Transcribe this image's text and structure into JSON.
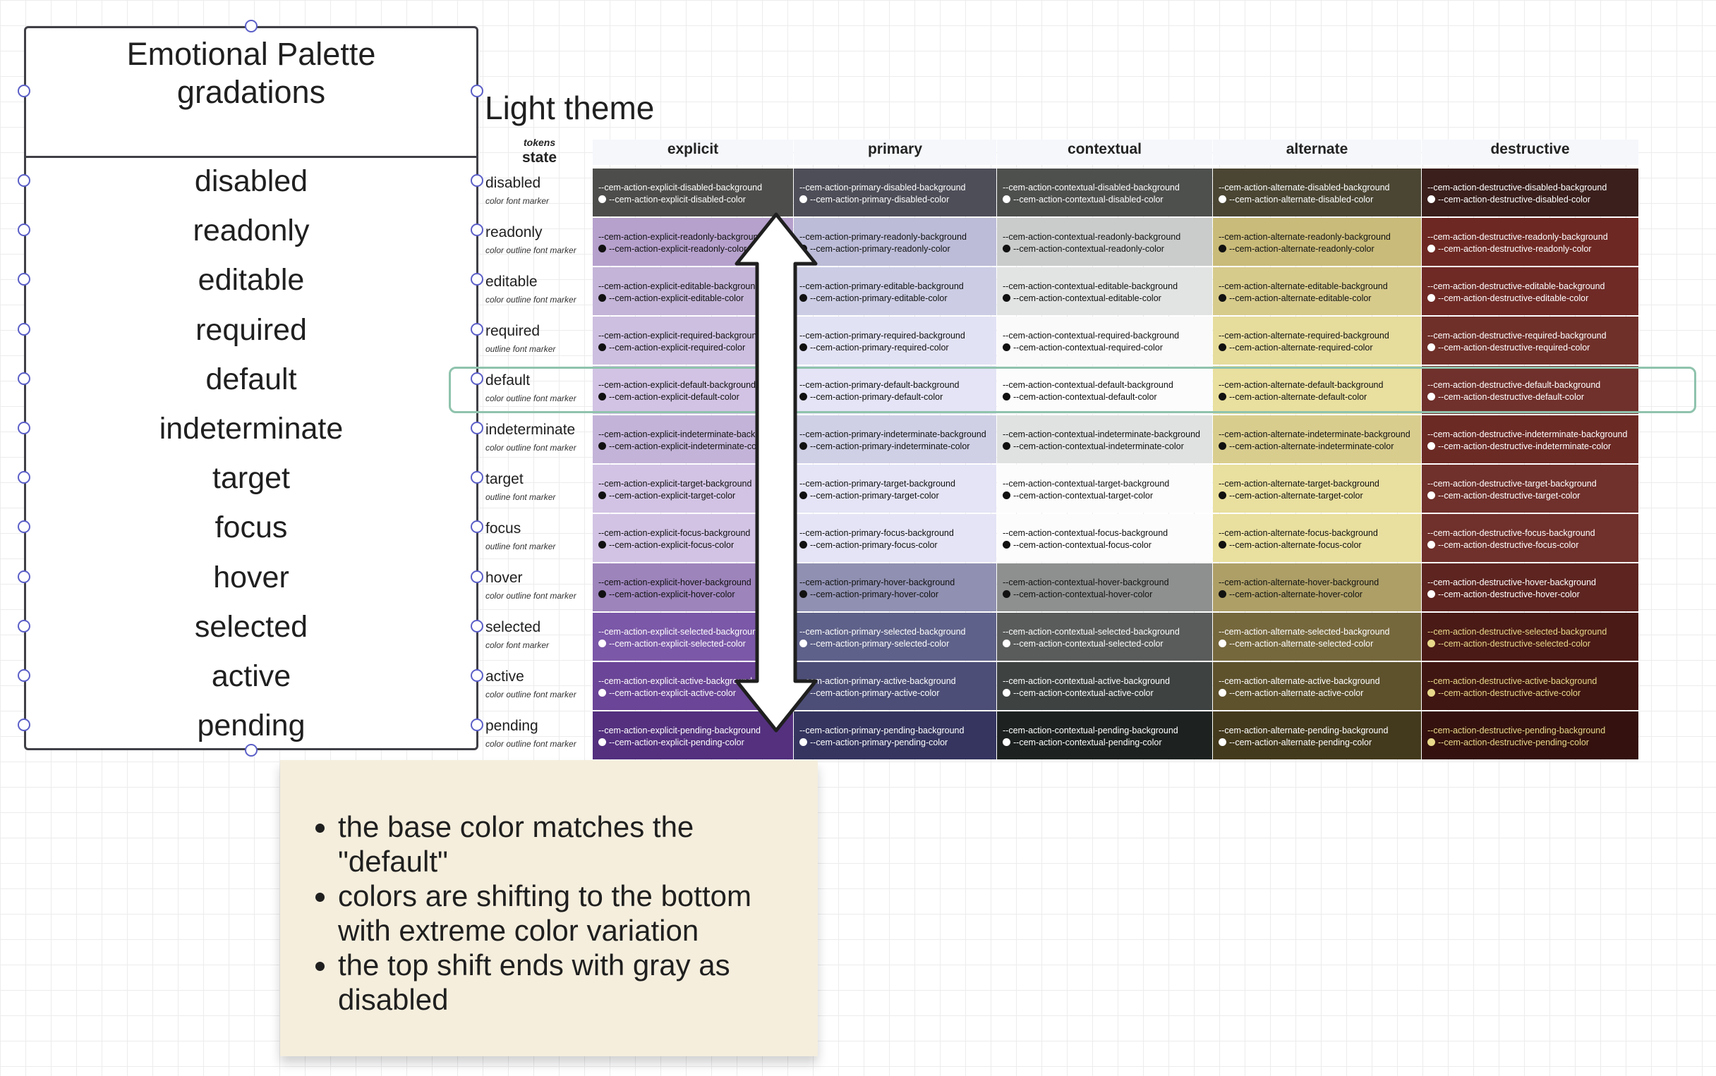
{
  "shape": {
    "title": "Emotional Palette gradations",
    "items": [
      "disabled",
      "readonly",
      "editable",
      "required",
      "default",
      "indeterminate",
      "target",
      "focus",
      "hover",
      "selected",
      "active",
      "pending"
    ]
  },
  "table": {
    "title": "Light theme",
    "tokens_label": "tokens",
    "state_label": "state",
    "columns": [
      "explicit",
      "primary",
      "contextual",
      "alternate",
      "destructive"
    ],
    "rows": [
      {
        "state": "disabled",
        "markers": "color font marker"
      },
      {
        "state": "readonly",
        "markers": "color outline font marker"
      },
      {
        "state": "editable",
        "markers": "color outline font marker"
      },
      {
        "state": "required",
        "markers": "outline font marker"
      },
      {
        "state": "default",
        "markers": "color outline font marker"
      },
      {
        "state": "indeterminate",
        "markers": "color outline font marker"
      },
      {
        "state": "target",
        "markers": "outline font marker"
      },
      {
        "state": "focus",
        "markers": "outline font marker"
      },
      {
        "state": "hover",
        "markers": "color outline font marker"
      },
      {
        "state": "selected",
        "markers": "color font marker"
      },
      {
        "state": "active",
        "markers": "color outline font marker"
      },
      {
        "state": "pending",
        "markers": "color outline font marker"
      }
    ],
    "cells": [
      [
        {
          "bg": "--cem-action-explicit-disabled-background",
          "fg": "--cem-action-explicit-disabled-color",
          "fill": "#4d4d4b",
          "text": "#ffffff"
        },
        {
          "bg": "--cem-action-primary-disabled-background",
          "fg": "--cem-action-primary-disabled-color",
          "fill": "#4e4e59",
          "text": "#ffffff"
        },
        {
          "bg": "--cem-action-contextual-disabled-background",
          "fg": "--cem-action-contextual-disabled-color",
          "fill": "#4e504e",
          "text": "#ffffff"
        },
        {
          "bg": "--cem-action-alternate-disabled-background",
          "fg": "--cem-action-alternate-disabled-color",
          "fill": "#4a4633",
          "text": "#ffffff"
        },
        {
          "bg": "--cem-action-destructive-disabled-background",
          "fg": "--cem-action-destructive-disabled-color",
          "fill": "#3a1f1c",
          "text": "#ffffff"
        }
      ],
      [
        {
          "bg": "--cem-action-explicit-readonly-background",
          "fg": "--cem-action-explicit-readonly-color",
          "fill": "#b6a1cd",
          "text": "#111111"
        },
        {
          "bg": "--cem-action-primary-readonly-background",
          "fg": "--cem-action-primary-readonly-color",
          "fill": "#bcbcd8",
          "text": "#111111"
        },
        {
          "bg": "--cem-action-contextual-readonly-background",
          "fg": "--cem-action-contextual-readonly-color",
          "fill": "#cacccb",
          "text": "#111111"
        },
        {
          "bg": "--cem-action-alternate-readonly-background",
          "fg": "--cem-action-alternate-readonly-color",
          "fill": "#c9bb79",
          "text": "#111111"
        },
        {
          "bg": "--cem-action-destructive-readonly-background",
          "fg": "--cem-action-destructive-readonly-color",
          "fill": "#6e2823",
          "text": "#ffffff"
        }
      ],
      [
        {
          "bg": "--cem-action-explicit-editable-background",
          "fg": "--cem-action-explicit-editable-color",
          "fill": "#c4b4d8",
          "text": "#111111"
        },
        {
          "bg": "--cem-action-primary-editable-background",
          "fg": "--cem-action-primary-editable-color",
          "fill": "#cccde5",
          "text": "#111111"
        },
        {
          "bg": "--cem-action-contextual-editable-background",
          "fg": "--cem-action-contextual-editable-color",
          "fill": "#e2e4e3",
          "text": "#111111"
        },
        {
          "bg": "--cem-action-alternate-editable-background",
          "fg": "--cem-action-alternate-editable-color",
          "fill": "#d7cb8c",
          "text": "#111111"
        },
        {
          "bg": "--cem-action-destructive-editable-background",
          "fg": "--cem-action-destructive-editable-color",
          "fill": "#6f2a26",
          "text": "#ffffff"
        }
      ],
      [
        {
          "bg": "--cem-action-explicit-required-background",
          "fg": "--cem-action-explicit-required-color",
          "fill": "#cdbfe0",
          "text": "#111111"
        },
        {
          "bg": "--cem-action-primary-required-background",
          "fg": "--cem-action-primary-required-color",
          "fill": "#e2e2f5",
          "text": "#111111"
        },
        {
          "bg": "--cem-action-contextual-required-background",
          "fg": "--cem-action-contextual-required-color",
          "fill": "#fafafa",
          "text": "#111111"
        },
        {
          "bg": "--cem-action-alternate-required-background",
          "fg": "--cem-action-alternate-required-color",
          "fill": "#e6dc9c",
          "text": "#111111"
        },
        {
          "bg": "--cem-action-destructive-required-background",
          "fg": "--cem-action-destructive-required-color",
          "fill": "#70302a",
          "text": "#ffffff"
        }
      ],
      [
        {
          "bg": "--cem-action-explicit-default-background",
          "fg": "--cem-action-explicit-default-color",
          "fill": "#d2c3e4",
          "text": "#111111"
        },
        {
          "bg": "--cem-action-primary-default-background",
          "fg": "--cem-action-primary-default-color",
          "fill": "#e4e4f6",
          "text": "#111111"
        },
        {
          "bg": "--cem-action-contextual-default-background",
          "fg": "--cem-action-contextual-default-color",
          "fill": "#fcfcfc",
          "text": "#111111"
        },
        {
          "bg": "--cem-action-alternate-default-background",
          "fg": "--cem-action-alternate-default-color",
          "fill": "#e9df9e",
          "text": "#111111"
        },
        {
          "bg": "--cem-action-destructive-default-background",
          "fg": "--cem-action-destructive-default-color",
          "fill": "#70302b",
          "text": "#ffffff"
        }
      ],
      [
        {
          "bg": "--cem-action-explicit-indeterminate-background",
          "fg": "--cem-action-explicit-indeterminate-color",
          "fill": "#c3b3d8",
          "text": "#111111"
        },
        {
          "bg": "--cem-action-primary-indeterminate-background",
          "fg": "--cem-action-primary-indeterminate-color",
          "fill": "#cfd0e6",
          "text": "#111111"
        },
        {
          "bg": "--cem-action-contextual-indeterminate-background",
          "fg": "--cem-action-contextual-indeterminate-color",
          "fill": "#e0e2e1",
          "text": "#111111"
        },
        {
          "bg": "--cem-action-alternate-indeterminate-background",
          "fg": "--cem-action-alternate-indeterminate-color",
          "fill": "#d9cd8e",
          "text": "#111111"
        },
        {
          "bg": "--cem-action-destructive-indeterminate-background",
          "fg": "--cem-action-destructive-indeterminate-color",
          "fill": "#6c2a25",
          "text": "#ffffff"
        }
      ],
      [
        {
          "bg": "--cem-action-explicit-target-background",
          "fg": "--cem-action-explicit-target-color",
          "fill": "#d2c3e4",
          "text": "#111111"
        },
        {
          "bg": "--cem-action-primary-target-background",
          "fg": "--cem-action-primary-target-color",
          "fill": "#e4e4f6",
          "text": "#111111"
        },
        {
          "bg": "--cem-action-contextual-target-background",
          "fg": "--cem-action-contextual-target-color",
          "fill": "#fcfcfc",
          "text": "#111111"
        },
        {
          "bg": "--cem-action-alternate-target-background",
          "fg": "--cem-action-alternate-target-color",
          "fill": "#e9df9e",
          "text": "#111111"
        },
        {
          "bg": "--cem-action-destructive-target-background",
          "fg": "--cem-action-destructive-target-color",
          "fill": "#70302b",
          "text": "#ffffff"
        }
      ],
      [
        {
          "bg": "--cem-action-explicit-focus-background",
          "fg": "--cem-action-explicit-focus-color",
          "fill": "#d2c3e4",
          "text": "#111111"
        },
        {
          "bg": "--cem-action-primary-focus-background",
          "fg": "--cem-action-primary-focus-color",
          "fill": "#e4e4f6",
          "text": "#111111"
        },
        {
          "bg": "--cem-action-contextual-focus-background",
          "fg": "--cem-action-contextual-focus-color",
          "fill": "#fcfcfc",
          "text": "#111111"
        },
        {
          "bg": "--cem-action-alternate-focus-background",
          "fg": "--cem-action-alternate-focus-color",
          "fill": "#e9df9e",
          "text": "#111111"
        },
        {
          "bg": "--cem-action-destructive-focus-background",
          "fg": "--cem-action-destructive-focus-color",
          "fill": "#70302b",
          "text": "#ffffff"
        }
      ],
      [
        {
          "bg": "--cem-action-explicit-hover-background",
          "fg": "--cem-action-explicit-hover-color",
          "fill": "#9d84bb",
          "text": "#111111"
        },
        {
          "bg": "--cem-action-primary-hover-background",
          "fg": "--cem-action-primary-hover-color",
          "fill": "#9090b2",
          "text": "#111111"
        },
        {
          "bg": "--cem-action-contextual-hover-background",
          "fg": "--cem-action-contextual-hover-color",
          "fill": "#8e908f",
          "text": "#111111"
        },
        {
          "bg": "--cem-action-alternate-hover-background",
          "fg": "--cem-action-alternate-hover-color",
          "fill": "#ad9f66",
          "text": "#111111"
        },
        {
          "bg": "--cem-action-destructive-hover-background",
          "fg": "--cem-action-destructive-hover-color",
          "fill": "#5d2420",
          "text": "#ffffff"
        }
      ],
      [
        {
          "bg": "--cem-action-explicit-selected-background",
          "fg": "--cem-action-explicit-selected-color",
          "fill": "#7b58a8",
          "text": "#ffffff"
        },
        {
          "bg": "--cem-action-primary-selected-background",
          "fg": "--cem-action-primary-selected-color",
          "fill": "#5e6189",
          "text": "#ffffff"
        },
        {
          "bg": "--cem-action-contextual-selected-background",
          "fg": "--cem-action-contextual-selected-color",
          "fill": "#595c5b",
          "text": "#ffffff"
        },
        {
          "bg": "--cem-action-alternate-selected-background",
          "fg": "--cem-action-alternate-selected-color",
          "fill": "#76683d",
          "text": "#ffffff"
        },
        {
          "bg": "--cem-action-destructive-selected-background",
          "fg": "--cem-action-destructive-selected-color",
          "fill": "#4a1a16",
          "text": "#e8d98a"
        }
      ],
      [
        {
          "bg": "--cem-action-explicit-active-background",
          "fg": "--cem-action-explicit-active-color",
          "fill": "#6b4597",
          "text": "#ffffff"
        },
        {
          "bg": "--cem-action-primary-active-background",
          "fg": "--cem-action-primary-active-color",
          "fill": "#4c4e77",
          "text": "#ffffff"
        },
        {
          "bg": "--cem-action-contextual-active-background",
          "fg": "--cem-action-contextual-active-color",
          "fill": "#3e4342",
          "text": "#ffffff"
        },
        {
          "bg": "--cem-action-alternate-active-background",
          "fg": "--cem-action-alternate-active-color",
          "fill": "#5e522d",
          "text": "#ffffff"
        },
        {
          "bg": "--cem-action-destructive-active-background",
          "fg": "--cem-action-destructive-active-color",
          "fill": "#401612",
          "text": "#e8d98a"
        }
      ],
      [
        {
          "bg": "--cem-action-explicit-pending-background",
          "fg": "--cem-action-explicit-pending-color",
          "fill": "#54307f",
          "text": "#ffffff"
        },
        {
          "bg": "--cem-action-primary-pending-background",
          "fg": "--cem-action-primary-pending-color",
          "fill": "#353560",
          "text": "#ffffff"
        },
        {
          "bg": "--cem-action-contextual-pending-background",
          "fg": "--cem-action-contextual-pending-color",
          "fill": "#1d2221",
          "text": "#ffffff"
        },
        {
          "bg": "--cem-action-alternate-pending-background",
          "fg": "--cem-action-alternate-pending-color",
          "fill": "#43391c",
          "text": "#ffffff"
        },
        {
          "bg": "--cem-action-destructive-pending-background",
          "fg": "--cem-action-destructive-pending-color",
          "fill": "#34110e",
          "text": "#e8d98a"
        }
      ]
    ]
  },
  "note": {
    "items": [
      "the base color matches the \"default\"",
      "colors are shifting to the bottom with extreme color variation",
      "the top shift ends with gray as disabled"
    ]
  },
  "colors": {
    "shape_border": "#3f3f46",
    "handle": "#5b5fc7",
    "highlight": "#8fc3ad",
    "note_bg": "#f5eedd"
  }
}
